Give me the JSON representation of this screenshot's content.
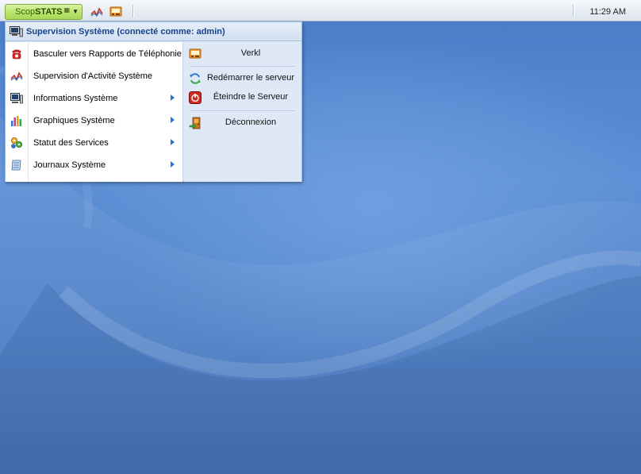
{
  "taskbar": {
    "start_button": {
      "label_part1": "Scop",
      "label_part2": "STATS",
      "mark": "▦"
    },
    "quick_launch": [
      {
        "icon": "activity-graph-icon"
      },
      {
        "icon": "server-monitor-icon"
      }
    ],
    "clock": "11:29 AM"
  },
  "start_menu": {
    "title": "Supervision Système (connecté comme: admin)",
    "items": [
      {
        "label": "Basculer vers Rapports de Téléphonie",
        "icon": "telephone-icon",
        "submenu": false
      },
      {
        "label": "Supervision d'Activité Système",
        "icon": "activity-graph-icon",
        "submenu": false
      },
      {
        "label": "Informations Système",
        "icon": "computer-icon",
        "submenu": true
      },
      {
        "label": "Graphiques Système",
        "icon": "bar-chart-icon",
        "submenu": true
      },
      {
        "label": "Statut des Services",
        "icon": "services-gears-icon",
        "submenu": true
      },
      {
        "label": "Journaux Système",
        "icon": "journal-icon",
        "submenu": true
      }
    ],
    "tools": [
      {
        "label": "Verkl",
        "icon": "server-monitor-icon"
      },
      {
        "label": "Redémarrer le serveur",
        "icon": "restart-icon"
      },
      {
        "label": "Éteindre le Serveur",
        "icon": "power-icon"
      },
      {
        "label": "Déconnexion",
        "icon": "logout-door-icon"
      }
    ]
  },
  "colors": {
    "desktop": "#4a7ec8",
    "menu_header_text": "#15428b",
    "start_button": "#b8e36a"
  }
}
